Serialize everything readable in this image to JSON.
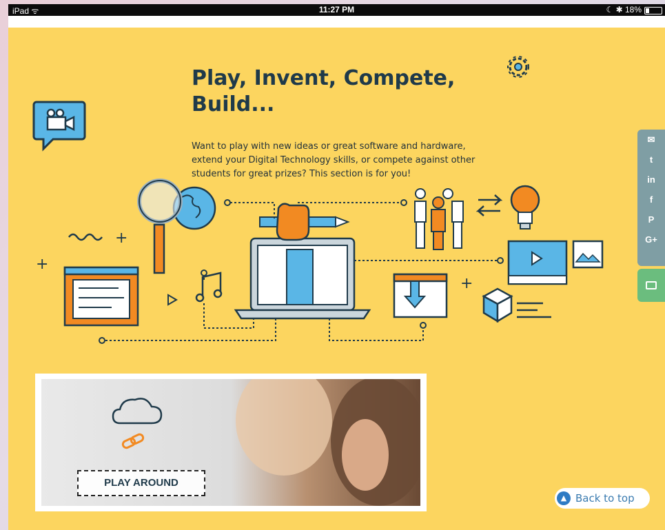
{
  "status_bar": {
    "device": "iPad ᯤ",
    "time": "11:27 PM",
    "battery": "☾ ✱ 18%"
  },
  "hero": {
    "title": "Play, Invent, Compete, Build...",
    "intro": "Want to play with new ideas or great software and hardware, extend your Digital Technology skills, or compete against other students for great prizes? This section is for you!"
  },
  "share": {
    "icons": [
      "✉",
      "t",
      "in",
      "f",
      "P",
      "G+"
    ]
  },
  "card": {
    "button_label": "PLAY AROUND"
  },
  "back_to_top": {
    "label": "Back to top",
    "icon": "▲"
  },
  "colors": {
    "background": "#fcd55f",
    "accent_orange": "#f28a22",
    "accent_blue": "#4fb6e4",
    "ink": "#1f3a4a"
  }
}
